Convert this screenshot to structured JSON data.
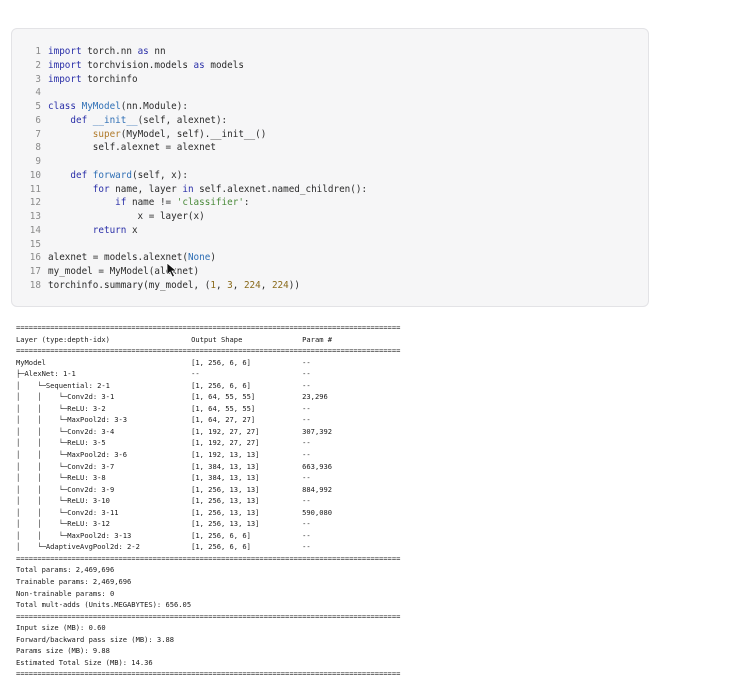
{
  "code": {
    "lines": [
      {
        "n": "1",
        "t": [
          [
            "kw",
            "import"
          ],
          [
            "p",
            " torch.nn "
          ],
          [
            "kw",
            "as"
          ],
          [
            "p",
            " nn"
          ]
        ]
      },
      {
        "n": "2",
        "t": [
          [
            "kw",
            "import"
          ],
          [
            "p",
            " torchvision.models "
          ],
          [
            "kw",
            "as"
          ],
          [
            "p",
            " models"
          ]
        ]
      },
      {
        "n": "3",
        "t": [
          [
            "kw",
            "import"
          ],
          [
            "p",
            " torchinfo"
          ]
        ]
      },
      {
        "n": "4",
        "t": []
      },
      {
        "n": "5",
        "t": [
          [
            "kw",
            "class"
          ],
          [
            "p",
            " "
          ],
          [
            "name",
            "MyModel"
          ],
          [
            "p",
            "(nn.Module):"
          ]
        ]
      },
      {
        "n": "6",
        "t": [
          [
            "p",
            "    "
          ],
          [
            "kw",
            "def"
          ],
          [
            "p",
            " "
          ],
          [
            "name",
            "__init__"
          ],
          [
            "p",
            "(self, alexnet):"
          ]
        ]
      },
      {
        "n": "7",
        "t": [
          [
            "p",
            "        "
          ],
          [
            "builtin",
            "super"
          ],
          [
            "p",
            "(MyModel, self).__init__()"
          ]
        ]
      },
      {
        "n": "8",
        "t": [
          [
            "p",
            "        self.alexnet = alexnet"
          ]
        ]
      },
      {
        "n": "9",
        "t": []
      },
      {
        "n": "10",
        "t": [
          [
            "p",
            "    "
          ],
          [
            "kw",
            "def"
          ],
          [
            "p",
            " "
          ],
          [
            "name",
            "forward"
          ],
          [
            "p",
            "(self, x):"
          ]
        ]
      },
      {
        "n": "11",
        "t": [
          [
            "p",
            "        "
          ],
          [
            "kw",
            "for"
          ],
          [
            "p",
            " name, layer "
          ],
          [
            "kw",
            "in"
          ],
          [
            "p",
            " self.alexnet.named_children():"
          ]
        ]
      },
      {
        "n": "12",
        "t": [
          [
            "p",
            "            "
          ],
          [
            "kw",
            "if"
          ],
          [
            "p",
            " name != "
          ],
          [
            "str",
            "'classifier'"
          ],
          [
            "p",
            ":"
          ]
        ]
      },
      {
        "n": "13",
        "t": [
          [
            "p",
            "                x = layer(x)"
          ]
        ]
      },
      {
        "n": "14",
        "t": [
          [
            "p",
            "        "
          ],
          [
            "kw",
            "return"
          ],
          [
            "p",
            " x"
          ]
        ]
      },
      {
        "n": "15",
        "t": []
      },
      {
        "n": "16",
        "t": [
          [
            "p",
            "alexnet = models.alexnet("
          ],
          [
            "const",
            "None"
          ],
          [
            "p",
            ")"
          ]
        ]
      },
      {
        "n": "17",
        "t": [
          [
            "p",
            "my_model = MyModel(alexnet)"
          ]
        ]
      },
      {
        "n": "18",
        "t": [
          [
            "p",
            "torchinfo.summary(my_model, ("
          ],
          [
            "num",
            "1"
          ],
          [
            "p",
            ", "
          ],
          [
            "num",
            "3"
          ],
          [
            "p",
            ", "
          ],
          [
            "num",
            "224"
          ],
          [
            "p",
            ", "
          ],
          [
            "num",
            "224"
          ],
          [
            "p",
            "))"
          ]
        ]
      }
    ]
  },
  "output": {
    "lines": [
      "==========================================================================================",
      "Layer (type:depth-idx)                   Output Shape              Param #",
      "==========================================================================================",
      "MyModel                                  [1, 256, 6, 6]            --",
      "├─AlexNet: 1-1                           --                        --",
      "│    └─Sequential: 2-1                   [1, 256, 6, 6]            --",
      "│    │    └─Conv2d: 3-1                  [1, 64, 55, 55]           23,296",
      "│    │    └─ReLU: 3-2                    [1, 64, 55, 55]           --",
      "│    │    └─MaxPool2d: 3-3               [1, 64, 27, 27]           --",
      "│    │    └─Conv2d: 3-4                  [1, 192, 27, 27]          307,392",
      "│    │    └─ReLU: 3-5                    [1, 192, 27, 27]          --",
      "│    │    └─MaxPool2d: 3-6               [1, 192, 13, 13]          --",
      "│    │    └─Conv2d: 3-7                  [1, 384, 13, 13]          663,936",
      "│    │    └─ReLU: 3-8                    [1, 384, 13, 13]          --",
      "│    │    └─Conv2d: 3-9                  [1, 256, 13, 13]          884,992",
      "│    │    └─ReLU: 3-10                   [1, 256, 13, 13]          --",
      "│    │    └─Conv2d: 3-11                 [1, 256, 13, 13]          590,080",
      "│    │    └─ReLU: 3-12                   [1, 256, 13, 13]          --",
      "│    │    └─MaxPool2d: 3-13              [1, 256, 6, 6]            --",
      "│    └─AdaptiveAvgPool2d: 2-2            [1, 256, 6, 6]            --",
      "==========================================================================================",
      "Total params: 2,469,696",
      "Trainable params: 2,469,696",
      "Non-trainable params: 0",
      "Total mult-adds (Units.MEGABYTES): 656.05",
      "==========================================================================================",
      "Input size (MB): 0.60",
      "Forward/backward pass size (MB): 3.88",
      "Params size (MB): 9.88",
      "Estimated Total Size (MB): 14.36",
      "=========================================================================================="
    ]
  },
  "cursor": {
    "icon": "arrow-cursor-icon"
  }
}
